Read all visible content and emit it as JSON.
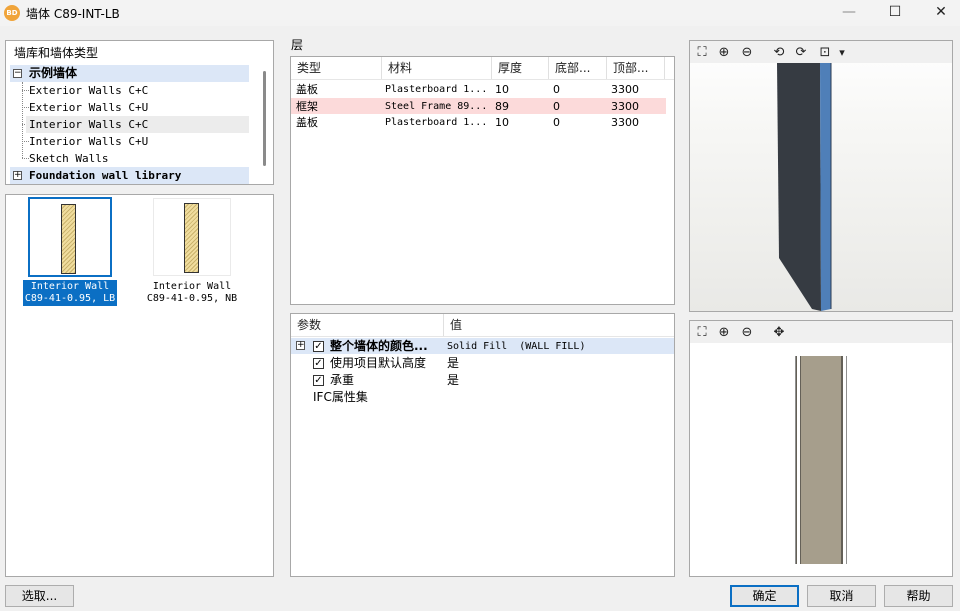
{
  "window": {
    "title": "墙体 C89-INT-LB",
    "app_icon": "BD",
    "minimize_glyph": "—",
    "maximize_glyph": "☐",
    "close_glyph": "✕"
  },
  "library": {
    "header": "墙库和墙体类型",
    "group_label": "示例墙体",
    "group_toggle": "−",
    "items": [
      "Exterior Walls C+C",
      "Exterior Walls C+U",
      "Interior Walls C+C",
      "Interior Walls C+U",
      "Sketch Walls"
    ],
    "foundation_label": "Foundation wall library",
    "foundation_toggle": "+"
  },
  "previews": [
    {
      "line1": "Interior Wall",
      "line2": "C89-41-0.95, LB"
    },
    {
      "line1": "Interior Wall",
      "line2": "C89-41-0.95, NB"
    }
  ],
  "layers": {
    "section_label": "层",
    "columns": [
      "类型",
      "材料",
      "厚度",
      "底部...",
      "顶部..."
    ],
    "rows": [
      [
        "盖板",
        "Plasterboard 1...",
        "10",
        "0",
        "3300"
      ],
      [
        "框架",
        "Steel Frame 89...",
        "89",
        "0",
        "3300"
      ],
      [
        "盖板",
        "Plasterboard 1...",
        "10",
        "0",
        "3300"
      ]
    ]
  },
  "params": {
    "columns": [
      "参数",
      "值"
    ],
    "rows": [
      {
        "name": "整个墙体的颜色...",
        "value": "Solid Fill  (WALL FILL)",
        "checked": true,
        "check_glyph": "✓",
        "expand": "+"
      },
      {
        "name": "使用项目默认高度",
        "value": "是",
        "checked": true,
        "check_glyph": "✓"
      },
      {
        "name": "承重",
        "value": "是",
        "checked": true,
        "check_glyph": "✓"
      },
      {
        "name": "IFC属性集",
        "value": ""
      }
    ]
  },
  "view3d_toolbar": {
    "zoom_extent": "⛶",
    "zoom_in": "⊕",
    "zoom_out": "⊖",
    "rotate_left": "⟲",
    "rotate_right": "⟳",
    "settings": "⊡",
    "dropdown": "▾"
  },
  "view2d_toolbar": {
    "zoom_extent": "⛶",
    "zoom_in": "⊕",
    "zoom_out": "⊖",
    "pan": "✥"
  },
  "buttons": {
    "select": "选取...",
    "ok": "确定",
    "cancel": "取消",
    "help": "帮助"
  },
  "colors": {
    "selection": "#0b6fc4",
    "row_highlight": "#fcdada",
    "group_highlight": "#dce7f7",
    "wall_face": "#363b42",
    "wall_edge": "#4f7fb8",
    "wall_fill": "#a69e8c"
  }
}
